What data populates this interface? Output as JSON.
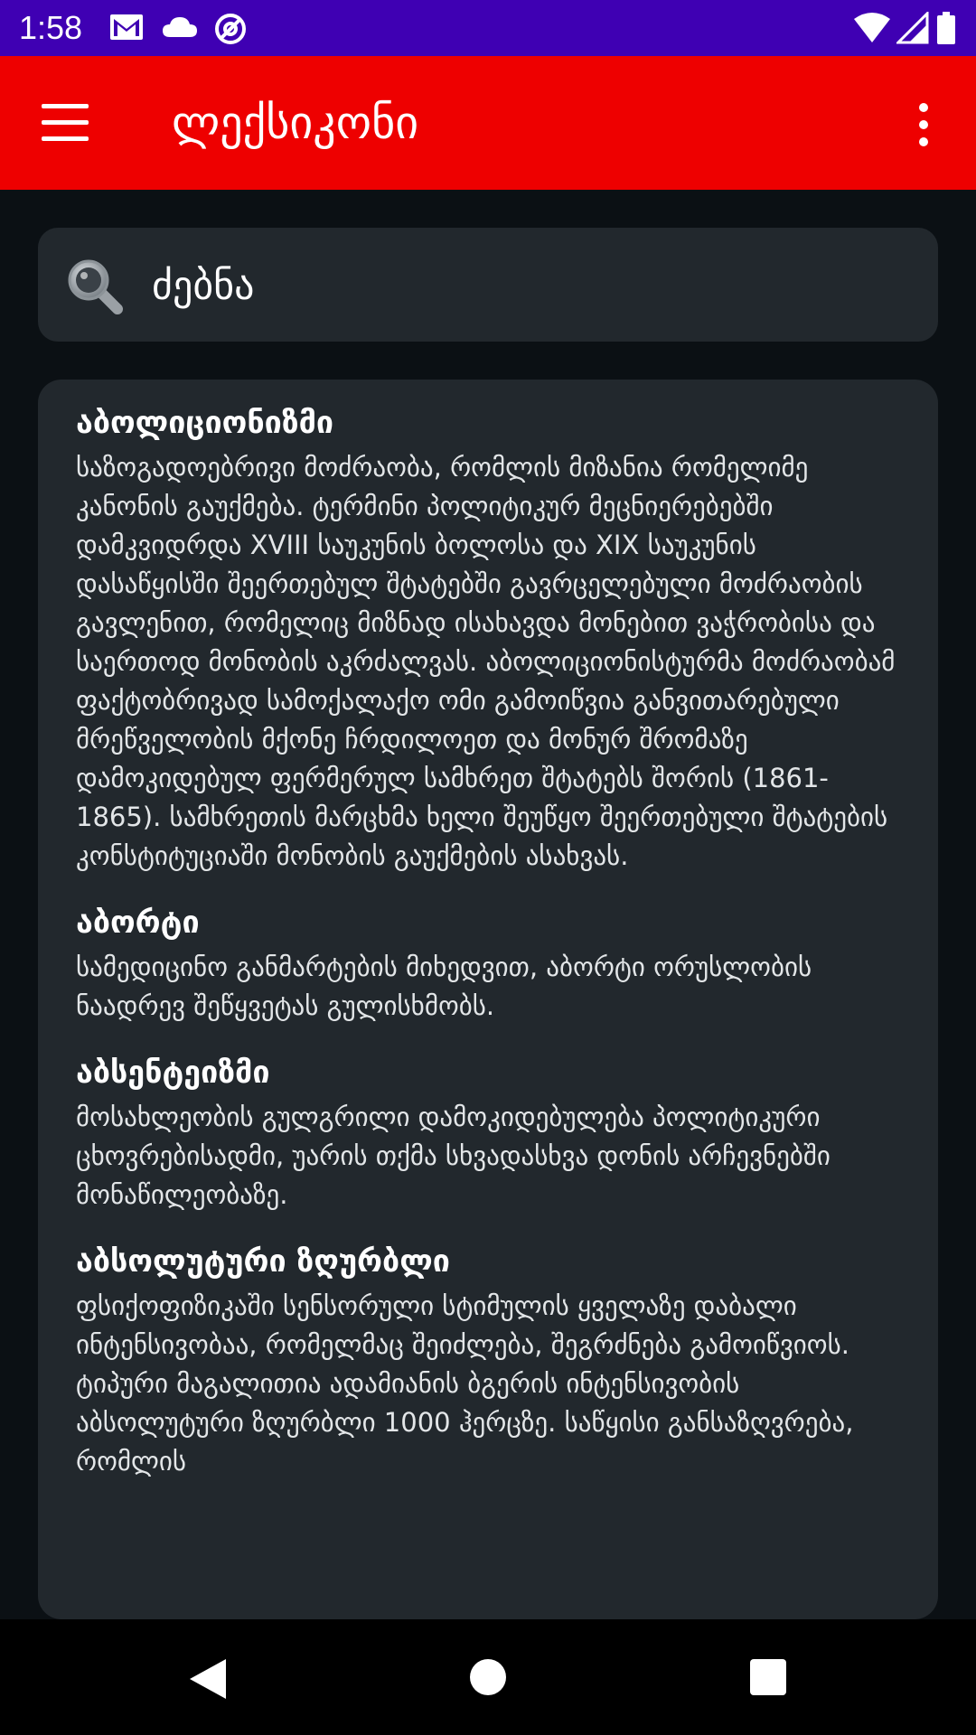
{
  "status_bar": {
    "time": "1:58",
    "left_icons": [
      "gmail-icon",
      "cloud-icon",
      "vpn-icon"
    ],
    "right_icons": [
      "wifi-icon",
      "signal-icon",
      "battery-icon"
    ],
    "background_color": "#3f00b3"
  },
  "app_bar": {
    "title": "ლექსიკონი",
    "menu_icon": "hamburger-menu-icon",
    "overflow_icon": "more-vert-icon",
    "background_color": "#ee0000"
  },
  "search": {
    "icon": "search-icon",
    "value": "ძებნა"
  },
  "entries": [
    {
      "term": "აბოლიციონიზმი",
      "definition": "საზოგადოებრივი მოძრაობა, რომლის მიზანია რომელიმე კანონის გაუქმება. ტერმინი პოლიტიკურ მეცნიერებებში დამკვიდრდა XVIII საუკუნის ბოლოსა და XIX საუკუნის დასაწყისში შეერთებულ შტატებში გავრცელებული მოძრაობის გავლენით, რომელიც მიზნად ისახავდა მონებით ვაჭრობისა და საერთოდ მონობის აკრძალვას. აბოლიციონისტურმა მოძრაობამ ფაქტობრივად სამოქალაქო ომი გამოიწვია განვითარებული მრეწველობის მქონე ჩრდილოეთ და მონურ შრომაზე დამოკიდებულ ფერმერულ სამხრეთ შტატებს შორის (1861-1865). სამხრეთის მარცხმა ხელი შეუწყო შეერთებული შტატების კონსტიტუციაში მონობის გაუქმების ასახვას."
    },
    {
      "term": "აბორტი",
      "definition": "სამედიცინო განმარტების მიხედვით, აბორტი ორუსლობის ნაადრევ შეწყვეტას გულისხმობს."
    },
    {
      "term": "აბსენტეიზმი",
      "definition": "მოსახლეობის გულგრილი დამოკიდებულება პოლიტიკური ცხოვრებისადმი, უარის თქმა სხვადასხვა დონის არჩევნებში მონაწილეობაზე."
    },
    {
      "term": "აბსოლუტური ზღურბლი",
      "definition": "ფსიქოფიზიკაში სენსორული სტიმულის ყველაზე დაბალი ინტენსივობაა, რომელმაც შეიძლება, შეგრძნება გამოიწვიოს. ტიპური მაგალითია ადამიანის ბგერის ინტენსივობის აბსოლუტური ზღურბლი 1000 ჰერცზე. საწყისი განსაზღვრება, რომლის"
    }
  ],
  "nav_bar": {
    "buttons": [
      "back-icon",
      "home-icon",
      "recents-icon"
    ]
  }
}
